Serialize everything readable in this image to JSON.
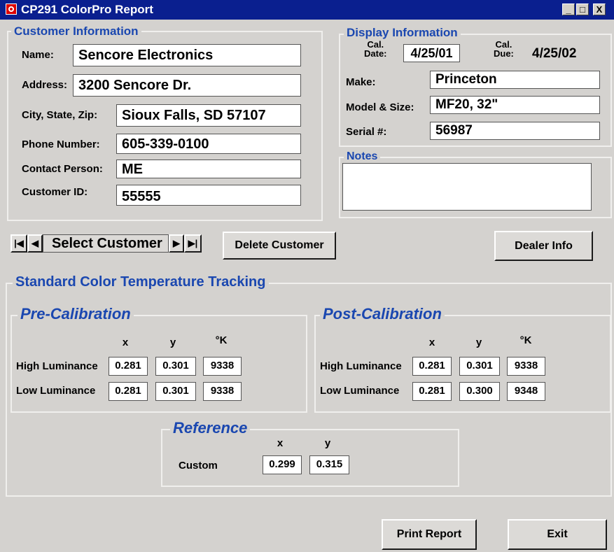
{
  "window": {
    "title": "CP291 ColorPro Report",
    "buttons": {
      "minimize": "_",
      "maximize": "□",
      "close": "X"
    },
    "colors": {
      "titlebar": "#0a1f8f",
      "legend": "#1a47b0",
      "background": "#d4d2cf"
    }
  },
  "customer": {
    "legend": "Customer Information",
    "name_label": "Name:",
    "name": "Sencore Electronics",
    "address_label": "Address:",
    "address": "3200 Sencore Dr.",
    "city_label": "City, State, Zip:",
    "city": "Sioux Falls, SD 57107",
    "phone_label": "Phone Number:",
    "phone": "605-339-0100",
    "contact_label": "Contact Person:",
    "contact": "ME",
    "id_label": "Customer ID:",
    "id": "55555"
  },
  "display": {
    "legend": "Display Information",
    "cal_date_label_1": "Cal.",
    "cal_date_label_2": "Date:",
    "cal_date": "4/25/01",
    "cal_due_label_1": "Cal.",
    "cal_due_label_2": "Due:",
    "cal_due": "4/25/02",
    "make_label": "Make:",
    "make": "Princeton",
    "model_label": "Model & Size:",
    "model": "MF20, 32\"",
    "serial_label": "Serial #:",
    "serial": "56987"
  },
  "notes": {
    "legend": "Notes",
    "value": ""
  },
  "navigator": {
    "first": "|◀",
    "prev": "◀",
    "label": "Select Customer",
    "next": "▶",
    "last": "▶|"
  },
  "buttons": {
    "delete": "Delete Customer",
    "dealer": "Dealer Info",
    "print": "Print Report",
    "exit": "Exit"
  },
  "tracking": {
    "legend": "Standard Color Temperature Tracking",
    "pre": {
      "legend": "Pre-Calibration",
      "headers": [
        "x",
        "y",
        "°K"
      ],
      "high_label": "High Luminance",
      "high": [
        "0.281",
        "0.301",
        "9338"
      ],
      "low_label": "Low Luminance",
      "low": [
        "0.281",
        "0.301",
        "9338"
      ]
    },
    "post": {
      "legend": "Post-Calibration",
      "headers": [
        "x",
        "y",
        "°K"
      ],
      "high_label": "High Luminance",
      "high": [
        "0.281",
        "0.301",
        "9338"
      ],
      "low_label": "Low Luminance",
      "low": [
        "0.281",
        "0.300",
        "9348"
      ]
    },
    "reference": {
      "legend": "Reference",
      "headers": [
        "x",
        "y"
      ],
      "custom_label": "Custom",
      "custom": [
        "0.299",
        "0.315"
      ]
    }
  }
}
